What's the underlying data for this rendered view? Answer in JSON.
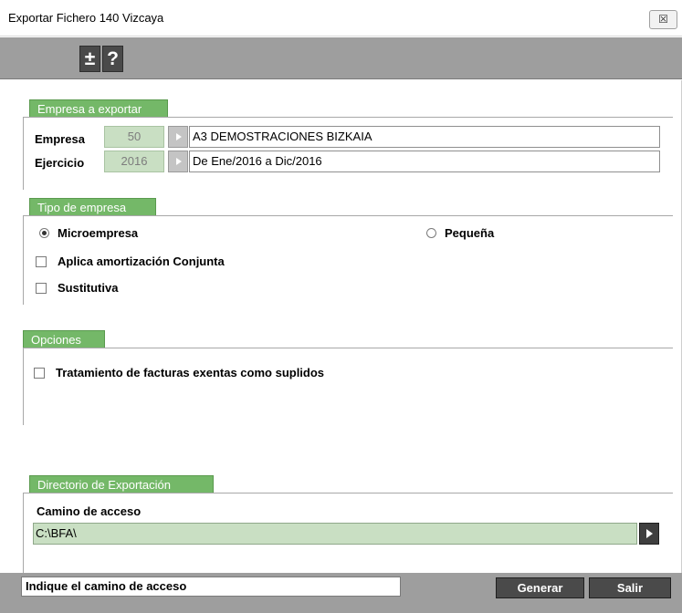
{
  "window": {
    "title": "Exportar Fichero 140 Vizcaya",
    "close_glyph": "☒"
  },
  "toolbar": {
    "plusminus_label": "±",
    "help_label": "?"
  },
  "empresa_section": {
    "title": "Empresa a exportar",
    "empresa_label": "Empresa",
    "empresa_code": "50",
    "empresa_name": "A3 DEMOSTRACIONES BIZKAIA",
    "ejercicio_label": "Ejercicio",
    "ejercicio_code": "2016",
    "ejercicio_desc": "De Ene/2016 a Dic/2016"
  },
  "tipo_section": {
    "title": "Tipo de empresa",
    "microempresa_label": "Microempresa",
    "microempresa_selected": true,
    "pequena_label": "Pequeña",
    "pequena_selected": false,
    "amortizacion_label": "Aplica amortización Conjunta",
    "amortizacion_checked": false,
    "sustitutiva_label": "Sustitutiva",
    "sustitutiva_checked": false
  },
  "opciones_section": {
    "title": "Opciones",
    "tratamiento_label": "Tratamiento de facturas exentas como suplidos",
    "tratamiento_checked": false
  },
  "directorio_section": {
    "title": "Directorio de Exportación",
    "camino_label": "Camino de acceso",
    "camino_value": "C:\\BFA\\"
  },
  "statusbar": {
    "message": "Indique el camino de acceso",
    "generar_label": "Generar",
    "salir_label": "Salir"
  },
  "colors": {
    "section_tab": "#74b868",
    "field_green": "#c9dfc3",
    "toolbar_gray": "#9e9e9e",
    "button_dark": "#4a4a4a"
  }
}
